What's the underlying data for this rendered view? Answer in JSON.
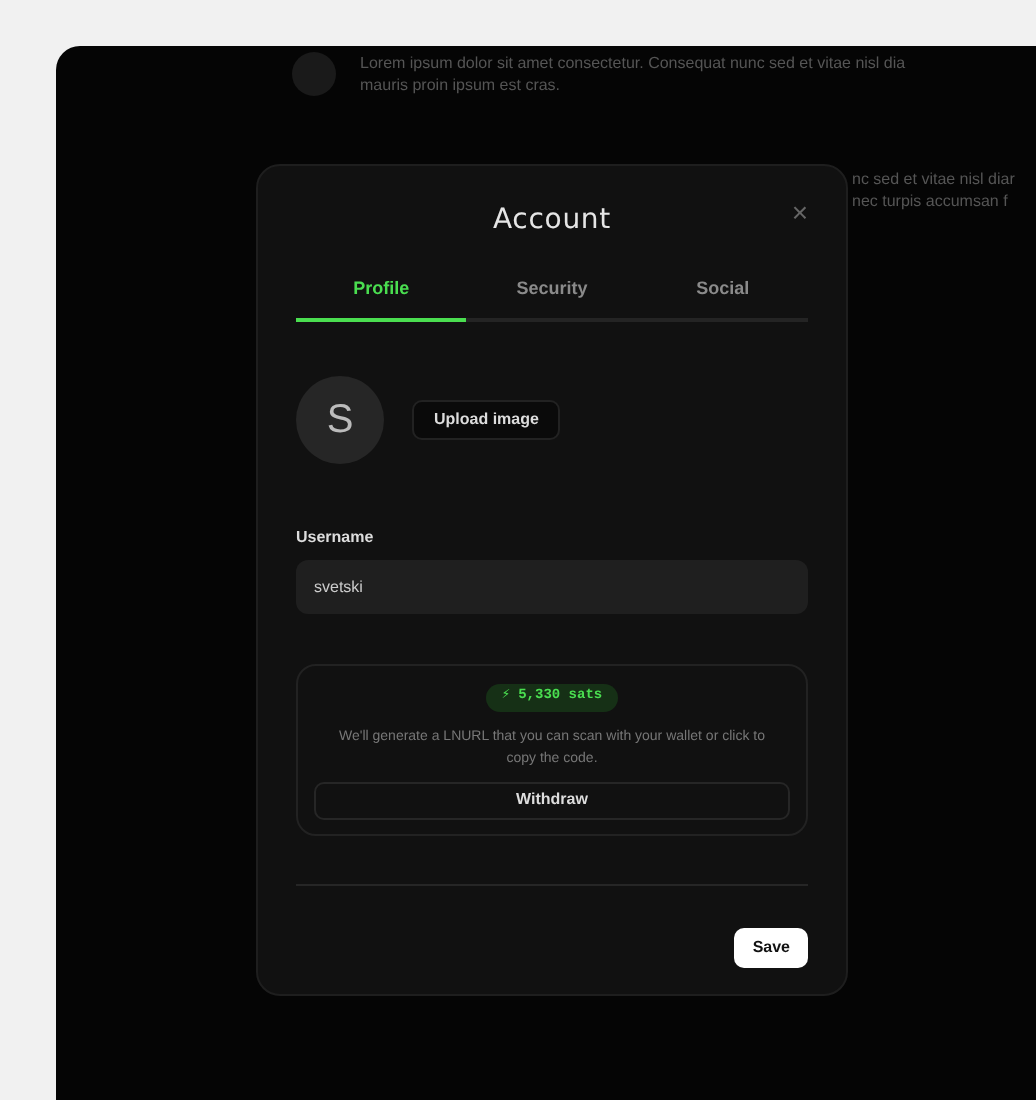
{
  "background": {
    "items": [
      {
        "lines": [
          "Lorem ipsum dolor sit amet consectetur. Consequat nunc sed et vitae nisl dia",
          "mauris proin ipsum est cras."
        ]
      },
      {
        "lines": [
          "nc sed et vitae nisl diar",
          "nec turpis accumsan f"
        ]
      }
    ]
  },
  "dialog": {
    "title": "Account",
    "close": "×",
    "tabs": [
      {
        "label": "Profile",
        "selected": true
      },
      {
        "label": "Security",
        "selected": false
      },
      {
        "label": "Social",
        "selected": false
      }
    ],
    "avatar": {
      "initial": "S"
    },
    "upload_button": "Upload image",
    "username": {
      "label": "Username",
      "value": "svetski"
    },
    "wallet": {
      "badge_icon": "⚡",
      "balance": "5,330 sats",
      "description": "We'll generate a LNURL that you can scan with your wallet or click to copy the code.",
      "button": "Withdraw"
    },
    "save_button": "Save"
  }
}
